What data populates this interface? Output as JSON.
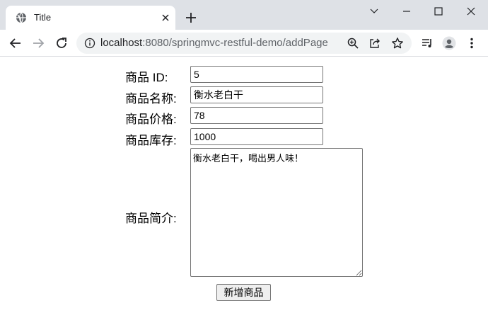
{
  "browser": {
    "tab_title": "Title",
    "url_host": "localhost",
    "url_path": ":8080/springmvc-restful-demo/addPage"
  },
  "form": {
    "id_label": "商品 ID:",
    "id_value": "5",
    "name_label": "商品名称:",
    "name_value": "衡水老白干",
    "price_label": "商品价格:",
    "price_value": "78",
    "stock_label": "商品库存:",
    "stock_value": "1000",
    "desc_label": "商品简介:",
    "desc_value": "衡水老白干，喝出男人味！",
    "submit_label": "新增商品"
  },
  "icons": {
    "favicon": "globe-icon",
    "close": "close-icon",
    "new_tab": "plus-icon",
    "back": "arrow-left-icon",
    "forward": "arrow-right-icon",
    "reload": "reload-icon",
    "info": "info-icon",
    "zoom": "zoom-icon",
    "share": "share-icon",
    "bookmark": "star-icon",
    "media": "media-queue-icon",
    "profile": "profile-icon",
    "menu": "kebab-menu-icon"
  },
  "colors": {
    "tab_strip": "#dee1e6",
    "omnibox": "#f1f3f4",
    "url_path": "#5f6368",
    "button_face": "#efefef"
  }
}
